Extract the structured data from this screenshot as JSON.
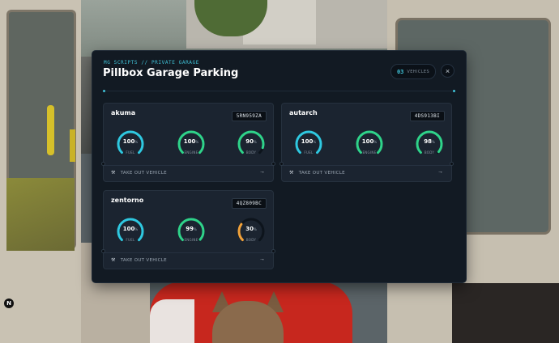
{
  "hud": {
    "badge": "N"
  },
  "garage": {
    "subtitle": "MG SCRIPTS // PRIVATE GARAGE",
    "title": "Pillbox Garage Parking",
    "count": "03",
    "count_label": "VEHICLES",
    "close_icon": "×",
    "accent": "#3fc1d6"
  },
  "vehicles": [
    {
      "name": "akuma",
      "plate": "5RN959ZA",
      "stats": [
        {
          "value": "100",
          "label": "FUEL",
          "level": 1.0,
          "color": "#2fc8e0"
        },
        {
          "value": "100",
          "label": "ENGINE",
          "level": 1.0,
          "color": "#2fd38a"
        },
        {
          "value": "90",
          "label": "BODY",
          "level": 0.9,
          "color": "#2fd38a"
        }
      ],
      "action": "TAKE OUT VEHICLE"
    },
    {
      "name": "autarch",
      "plate": "4DS913BI",
      "stats": [
        {
          "value": "100",
          "label": "FUEL",
          "level": 1.0,
          "color": "#2fc8e0"
        },
        {
          "value": "100",
          "label": "ENGINE",
          "level": 1.0,
          "color": "#2fd38a"
        },
        {
          "value": "98",
          "label": "BODY",
          "level": 0.98,
          "color": "#2fd38a"
        }
      ],
      "action": "TAKE OUT VEHICLE"
    },
    {
      "name": "zentorno",
      "plate": "4QZ809BC",
      "stats": [
        {
          "value": "100",
          "label": "FUEL",
          "level": 1.0,
          "color": "#2fc8e0"
        },
        {
          "value": "99",
          "label": "ENGINE",
          "level": 0.99,
          "color": "#2fd38a"
        },
        {
          "value": "30",
          "label": "BODY",
          "level": 0.3,
          "color": "#f2a23a"
        }
      ],
      "action": "TAKE OUT VEHICLE"
    }
  ],
  "icons": {
    "pct": "%",
    "wrench": "wrench-icon",
    "arrow": "arrow-right-icon"
  }
}
